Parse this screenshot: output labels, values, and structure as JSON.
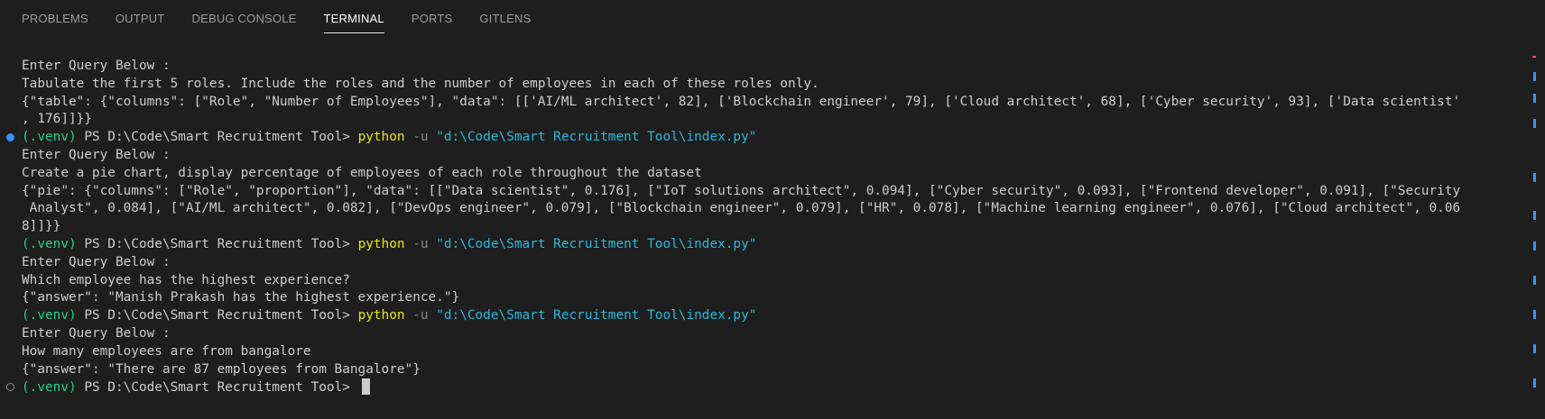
{
  "tabs": [
    "PROBLEMS",
    "OUTPUT",
    "DEBUG CONSOLE",
    "TERMINAL",
    "PORTS",
    "GITLENS"
  ],
  "active_tab": "TERMINAL",
  "prompt": {
    "venv": "(.venv)",
    "path": " PS D:\\Code\\Smart Recruitment Tool> ",
    "cmd": "python",
    "flag": " -u ",
    "script": "\"d:\\Code\\Smart Recruitment Tool\\index.py\""
  },
  "output": {
    "l1": "Enter Query Below :",
    "l2": "Tabulate the first 5 roles. Include the roles and the number of employees in each of these roles only.",
    "l3": "{\"table\": {\"columns\": [\"Role\", \"Number of Employees\"], \"data\": [['AI/ML architect', 82], ['Blockchain engineer', 79], ['Cloud architect', 68], ['Cyber security', 93], ['Data scientist'",
    "l4": ", 176]]}}",
    "l6": "Enter Query Below :",
    "l7": "Create a pie chart, display percentage of employees of each role throughout the dataset",
    "l8": "{\"pie\": {\"columns\": [\"Role\", \"proportion\"], \"data\": [[\"Data scientist\", 0.176], [\"IoT solutions architect\", 0.094], [\"Cyber security\", 0.093], [\"Frontend developer\", 0.091], [\"Security",
    "l9": " Analyst\", 0.084], [\"AI/ML architect\", 0.082], [\"DevOps engineer\", 0.079], [\"Blockchain engineer\", 0.079], [\"HR\", 0.078], [\"Machine learning engineer\", 0.076], [\"Cloud architect\", 0.06",
    "l10": "8]]}}",
    "l12": "Enter Query Below :",
    "l13": "Which employee has the highest experience?",
    "l14": "{\"answer\": \"Manish Prakash has the highest experience.\"}",
    "l16": "Enter Query Below :",
    "l17": "How many employees are from bangalore",
    "l18": "{\"answer\": \"There are 87 employees from Bangalore\"}"
  },
  "colors": {
    "background": "#1e1e1e",
    "text": "#cccccc",
    "venv_green": "#23d18b",
    "python_yellow": "#e5e510",
    "string_cyan": "#29b8db",
    "decoration_blue": "#3794ff"
  }
}
